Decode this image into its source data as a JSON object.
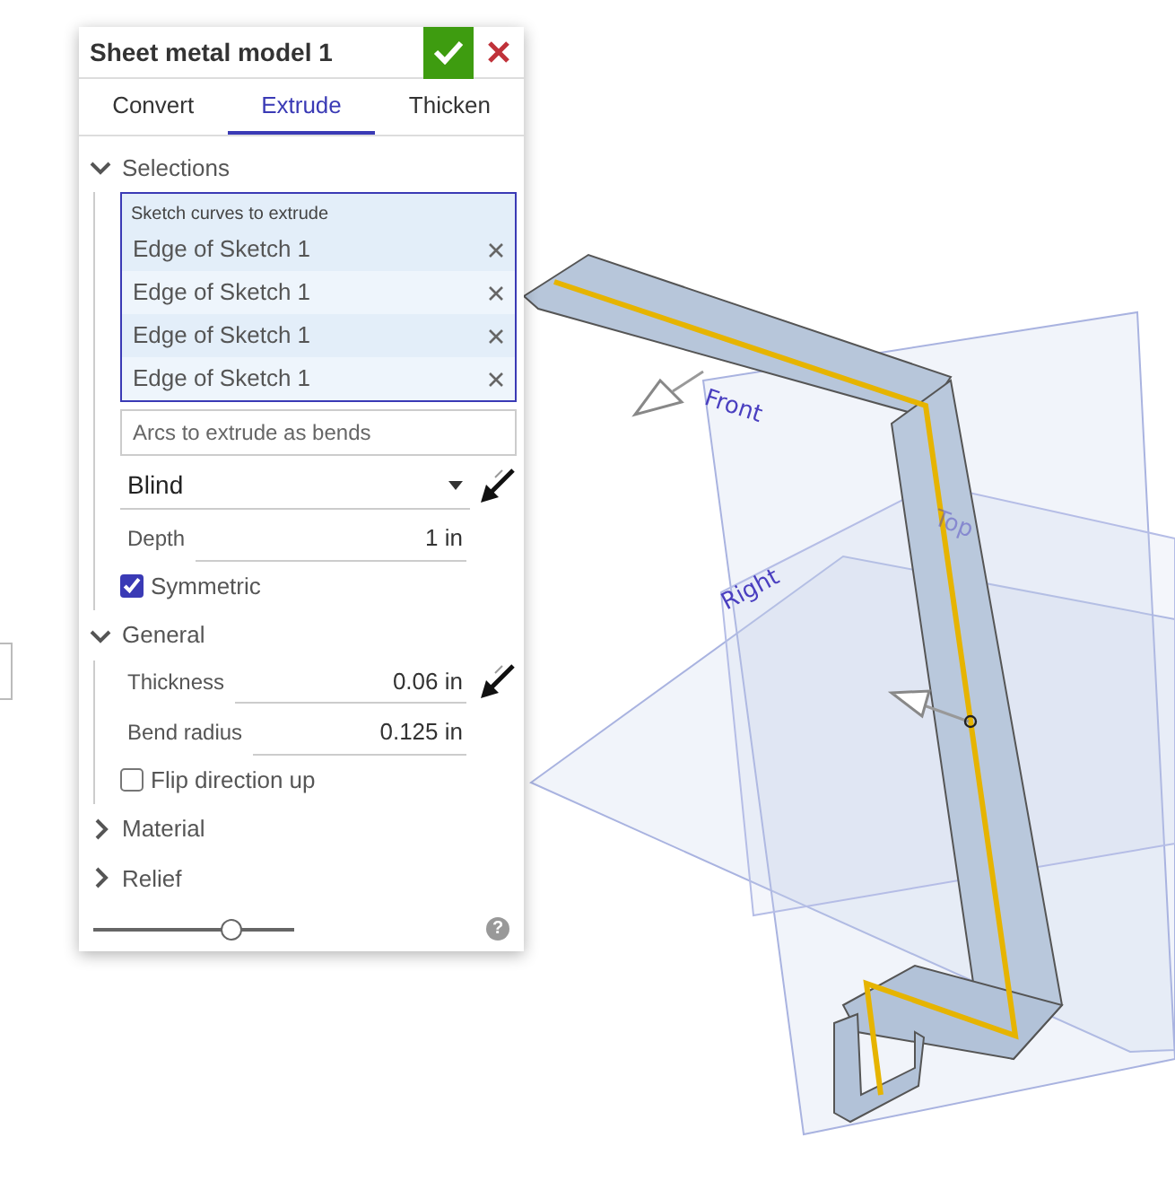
{
  "dialog": {
    "title": "Sheet metal model 1",
    "tabs": [
      {
        "label": "Convert",
        "selected": false
      },
      {
        "label": "Extrude",
        "selected": true
      },
      {
        "label": "Thicken",
        "selected": false
      }
    ],
    "sections": [
      {
        "title": "Selections",
        "expanded": true,
        "items": [
          {
            "kind": "query",
            "label": "Sketch curves to extrude",
            "rows": [
              "Edge of Sketch 1",
              "Edge of Sketch 1",
              "Edge of Sketch 1",
              "Edge of Sketch 1"
            ]
          },
          {
            "kind": "field",
            "placeholder": "Arcs to extrude as bends"
          },
          {
            "kind": "dropdown",
            "value": "Blind",
            "flip": true
          },
          {
            "kind": "number",
            "label": "Depth",
            "value": "1 in",
            "flip": false
          },
          {
            "kind": "checkbox",
            "label": "Symmetric",
            "checked": true
          }
        ]
      },
      {
        "title": "General",
        "expanded": true,
        "items": [
          {
            "kind": "number",
            "label": "Thickness",
            "value": "0.06 in",
            "flip": true
          },
          {
            "kind": "number",
            "label": "Bend radius",
            "value": "0.125 in",
            "flip": false
          },
          {
            "kind": "checkbox",
            "label": "Flip direction up",
            "checked": false
          }
        ]
      },
      {
        "title": "Material",
        "expanded": false
      },
      {
        "title": "Relief",
        "expanded": false
      }
    ],
    "slider": {
      "level": 0.69
    },
    "help": "?"
  },
  "viewport": {
    "plane_labels": [
      "Front",
      "Right",
      "Top"
    ]
  }
}
